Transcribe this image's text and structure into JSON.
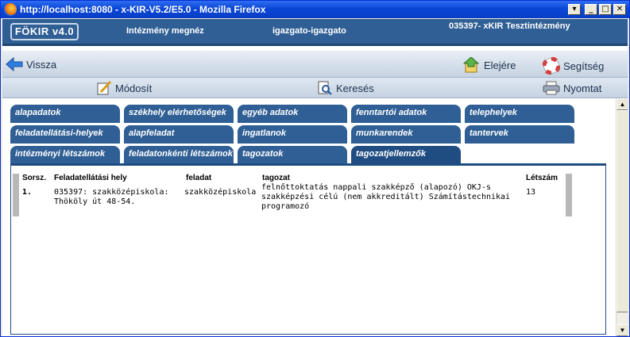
{
  "window": {
    "title": "http://localhost:8080 - x-KIR-V5.2/E5.0 - Mozilla Firefox"
  },
  "header": {
    "logo": "FÖKIR v4.0",
    "institution_label": "Intézmény megnéz",
    "user": "igazgato-igazgato",
    "institution": "035397- xKIR Tesztintézmény"
  },
  "nav": {
    "back": "Vissza",
    "home": "Elejére",
    "help": "Segítség"
  },
  "toolbar": {
    "modify": "Módosít",
    "search": "Keresés",
    "print": "Nyomtat"
  },
  "tabs": {
    "row1": [
      "alapadatok",
      "székhely elérhetőségek",
      "egyéb adatok",
      "fenntartói adatok",
      "telephelyek"
    ],
    "row2": [
      "feladatellátási-helyek",
      "alapfeladat",
      "ingatlanok",
      "munkarendek",
      "tantervek"
    ],
    "row3": [
      "intézményi létszámok",
      "feladatonkénti létszámok",
      "tagozatok",
      "tagozatjellemzők"
    ]
  },
  "table": {
    "headers": {
      "num": "Sorsz.",
      "place": "Feladatellátási hely",
      "task": "feladat",
      "section": "tagozat",
      "count": "Létszám"
    },
    "rows": [
      {
        "num": "1.",
        "place": "035397: szakközépiskola: Thököly út 48-54.",
        "task": "szakközépiskola",
        "section": "felnőttoktatás nappali szakképző (alapozó) OKJ-s szakképzési célú (nem akkreditált) Számítástechnikai programozó",
        "count": "13"
      }
    ]
  }
}
